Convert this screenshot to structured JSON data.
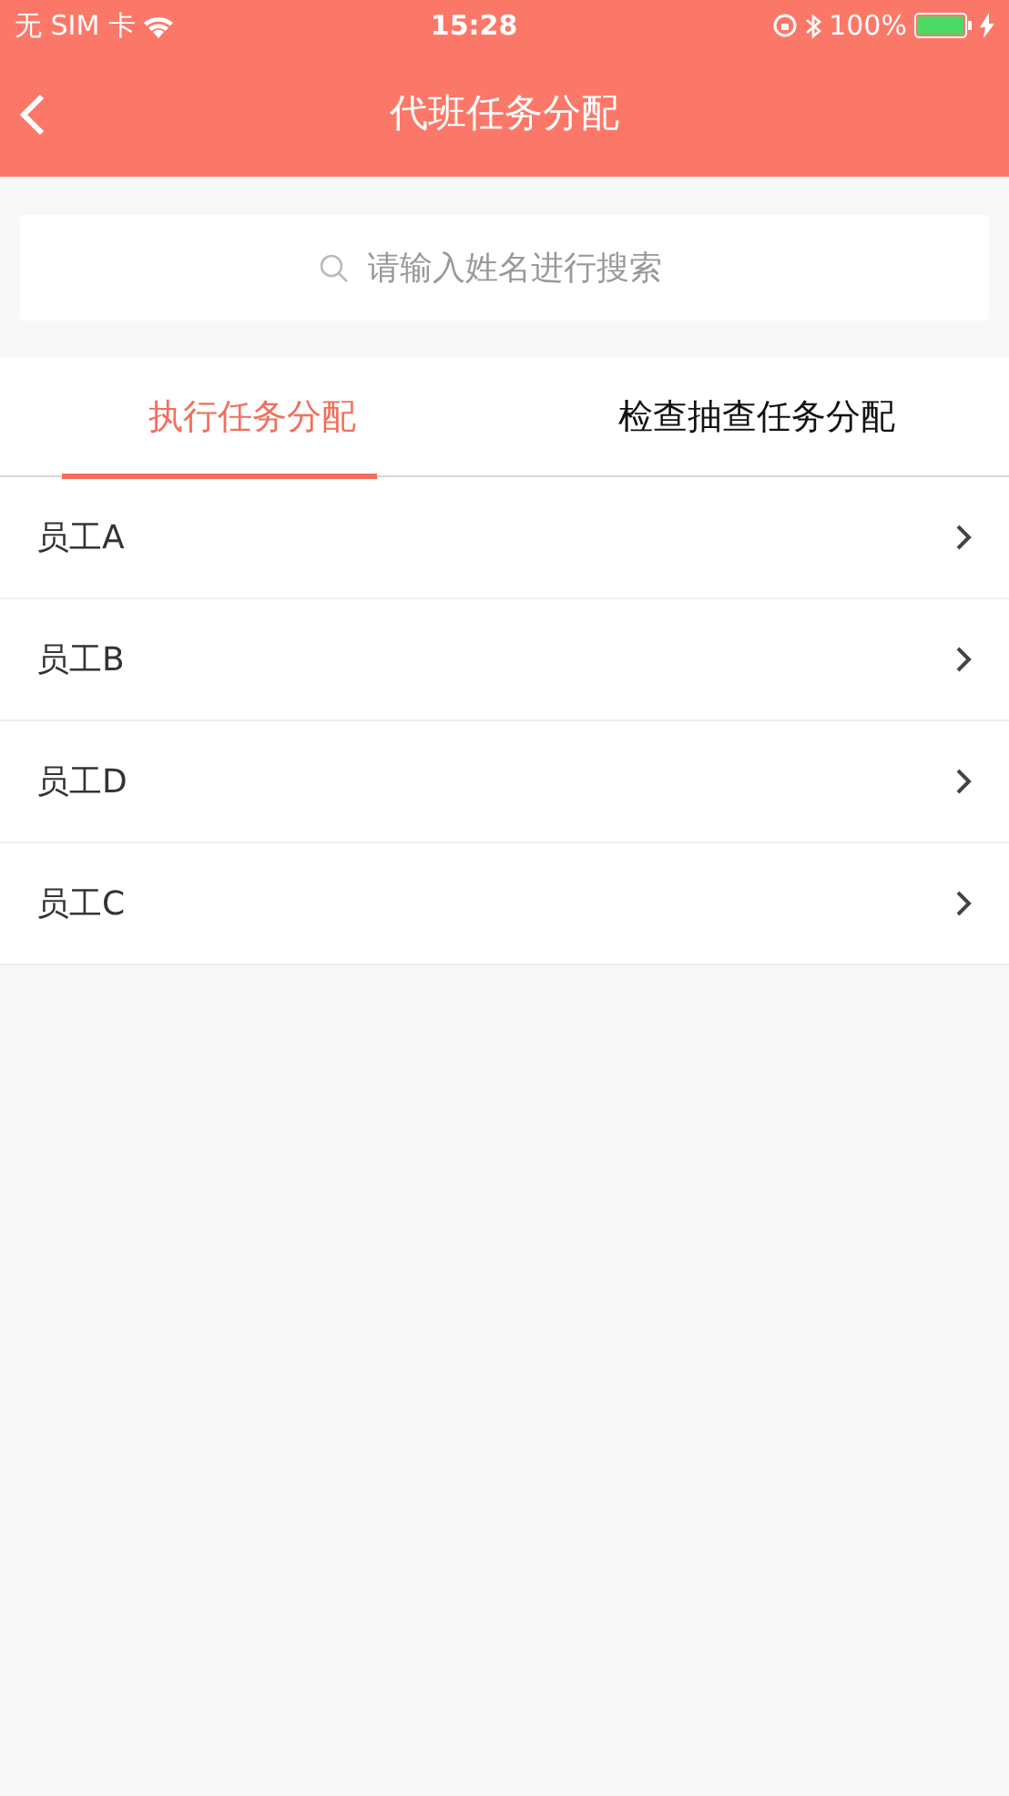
{
  "status_bar": {
    "carrier": "无 SIM 卡",
    "time": "15:28",
    "battery": "100%"
  },
  "nav_bar": {
    "title": "代班任务分配"
  },
  "search": {
    "placeholder": "请输入姓名进行搜索"
  },
  "tabs": [
    {
      "label": "执行任务分配",
      "selected": true
    },
    {
      "label": "检查抽查任务分配",
      "selected": false
    }
  ],
  "employees": [
    {
      "name": "员工A"
    },
    {
      "name": "员工B"
    },
    {
      "name": "员工D"
    },
    {
      "name": "员工C"
    }
  ]
}
